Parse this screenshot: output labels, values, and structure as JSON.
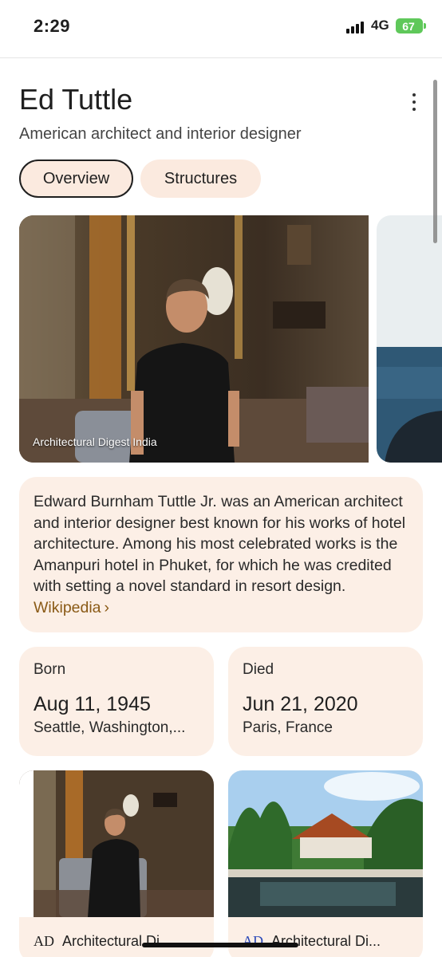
{
  "status": {
    "time": "2:29",
    "network": "4G",
    "battery": "67"
  },
  "header": {
    "title": "Ed Tuttle",
    "subtitle": "American architect and interior designer"
  },
  "tabs": [
    {
      "label": "Overview"
    },
    {
      "label": "Structures"
    }
  ],
  "hero": {
    "caption": "Architectural Digest India"
  },
  "description": {
    "text": "Edward Burnham Tuttle Jr. was an American architect and interior designer best known for his works of hotel architecture. Among his most celebrated works is the Amanpuri hotel in Phuket, for which he was credited with setting a novel standard in resort design.",
    "link": "Wikipedia",
    "link_chevron": "›"
  },
  "facts": [
    {
      "label": "Born",
      "value": "Aug 11, 1945",
      "detail": "Seattle, Washington,..."
    },
    {
      "label": "Died",
      "value": "Jun 21, 2020",
      "detail": "Paris, France"
    }
  ],
  "cards": [
    {
      "logo": "AD",
      "source": "Architectural Di..."
    },
    {
      "logo": "AD",
      "source": "Architectural Di..."
    }
  ],
  "colors": {
    "card_bg": "#fcefe6",
    "wiki_link": "#8a5a16",
    "battery": "#5fc85a"
  }
}
